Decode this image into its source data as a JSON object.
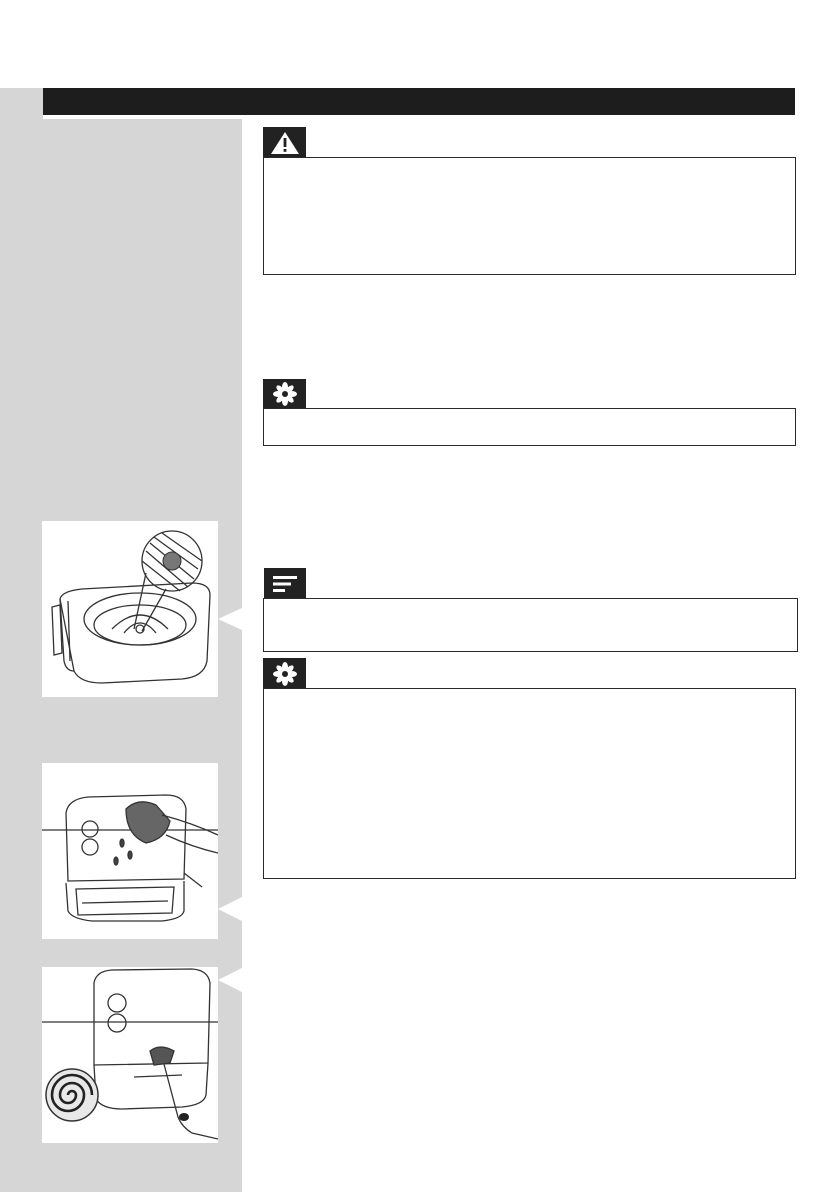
{
  "page": {
    "section_header": "",
    "icons": {
      "warning": "warning-triangle-icon",
      "tip": "asterisk-tip-icon",
      "note": "note-lines-icon"
    },
    "figures": [
      {
        "name": "basket-heating-element-illustration",
        "description": ""
      },
      {
        "name": "wipe-exterior-illustration",
        "description": ""
      },
      {
        "name": "brush-heating-coil-illustration",
        "description": ""
      }
    ]
  }
}
